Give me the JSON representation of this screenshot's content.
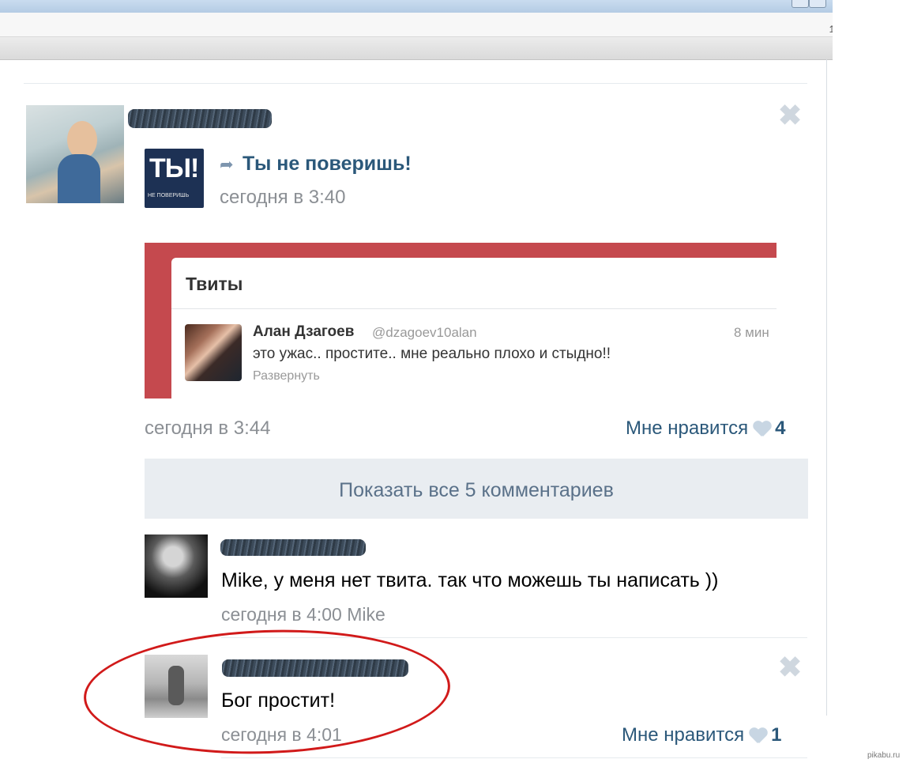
{
  "post": {
    "share_title": "Ты не поверишь!",
    "share_time": "сегодня в 3:40",
    "logo_big": "ТЫ!",
    "logo_small": "НЕ ПОВЕРИШЬ",
    "time": "сегодня в 3:44",
    "like_label": "Мне нравится",
    "like_count": "4",
    "show_all_comments": "Показать все 5 комментариев"
  },
  "tweet": {
    "header": "Твиты",
    "author": "Алан Дзагоев",
    "handle": "@dzagoev10alan",
    "age": "8 мин",
    "text": "это ужас.. простите.. мне реально плохо и стыдно!!",
    "expand": "Развернуть"
  },
  "comments": [
    {
      "text": "Mike, у меня нет твита. так что можешь ты написать ))",
      "time": "сегодня в 4:00",
      "reply_to": "Mike"
    },
    {
      "text": "Бог простит!",
      "time": "сегодня в 4:01",
      "like_label": "Мне нравится",
      "like_count": "1"
    }
  ],
  "watermark": "pikabu.ru",
  "icons": {
    "close": "close-icon",
    "share": "share-arrow-icon",
    "like": "heart-icon"
  },
  "colors": {
    "link": "#2b587a",
    "muted": "#8b8f94",
    "twitter_frame": "#c5494e",
    "annotation": "#d11a1a"
  }
}
